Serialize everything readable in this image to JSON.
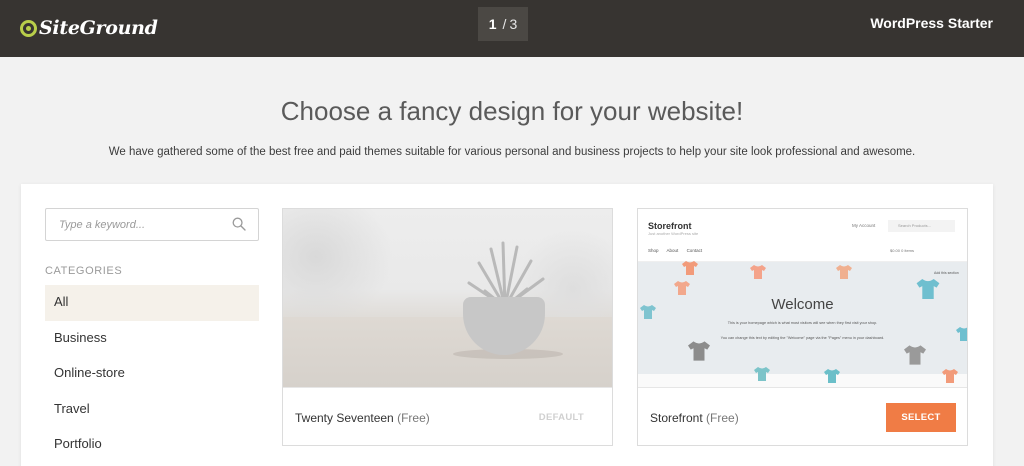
{
  "header": {
    "logo_text": "SiteGround",
    "step_current": "1",
    "step_separator": "/",
    "step_total": "3",
    "plan_name": "WordPress Starter"
  },
  "intro": {
    "title": "Choose a fancy design for your website!",
    "subtitle": "We have gathered some of the best free and paid themes suitable for various personal and business projects to help your site look professional and awesome."
  },
  "search": {
    "placeholder": "Type a keyword..."
  },
  "categories": {
    "title": "CATEGORIES",
    "items": [
      {
        "label": "All",
        "active": true
      },
      {
        "label": "Business",
        "active": false
      },
      {
        "label": "Online-store",
        "active": false
      },
      {
        "label": "Travel",
        "active": false
      },
      {
        "label": "Portfolio",
        "active": false
      }
    ]
  },
  "themes": [
    {
      "name": "Twenty Seventeen",
      "price": "(Free)",
      "action": "DEFAULT"
    },
    {
      "name": "Storefront",
      "price": "(Free)",
      "action": "SELECT",
      "preview": {
        "brand": "Storefront",
        "tagline": "Just another WordPress site",
        "account": "My Account",
        "search": "Search Products...",
        "nav": [
          "Shop",
          "About",
          "Contact"
        ],
        "cart": "$0.00   0 items",
        "tag": "Add this section",
        "welcome": "Welcome",
        "line1": "This is your homepage which is what most visitors will see when they first visit your shop.",
        "line2": "You can change this text by editing the \"Welcome\" page via the \"Pages\" menu in your dashboard."
      }
    }
  ],
  "colors": {
    "topbar": "#373431",
    "accent_button": "#f07c45",
    "logo_green": "#b9cf4a",
    "active_category": "#f5f1ea"
  }
}
